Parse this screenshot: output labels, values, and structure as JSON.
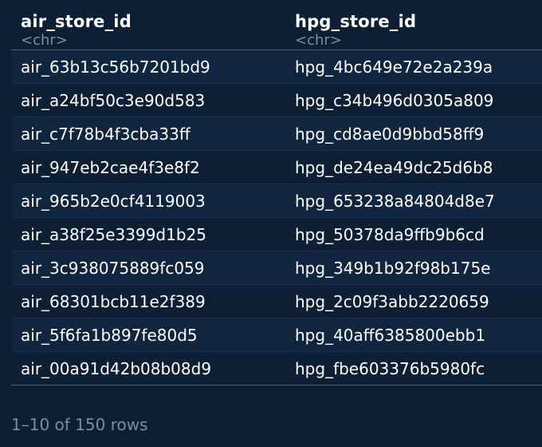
{
  "table": {
    "columns": [
      {
        "name": "air_store_id",
        "type": "<chr>"
      },
      {
        "name": "hpg_store_id",
        "type": "<chr>"
      }
    ],
    "rows": [
      [
        "air_63b13c56b7201bd9",
        "hpg_4bc649e72e2a239a"
      ],
      [
        "air_a24bf50c3e90d583",
        "hpg_c34b496d0305a809"
      ],
      [
        "air_c7f78b4f3cba33ff",
        "hpg_cd8ae0d9bbd58ff9"
      ],
      [
        "air_947eb2cae4f3e8f2",
        "hpg_de24ea49dc25d6b8"
      ],
      [
        "air_965b2e0cf4119003",
        "hpg_653238a84804d8e7"
      ],
      [
        "air_a38f25e3399d1b25",
        "hpg_50378da9ffb9b6cd"
      ],
      [
        "air_3c938075889fc059",
        "hpg_349b1b92f98b175e"
      ],
      [
        "air_68301bcb11e2f389",
        "hpg_2c09f3abb2220659"
      ],
      [
        "air_5f6fa1b897fe80d5",
        "hpg_40aff6385800ebb1"
      ],
      [
        "air_00a91d42b08b08d9",
        "hpg_fbe603376b5980fc"
      ]
    ]
  },
  "footer": {
    "pagination_text": "1–10 of 150 rows"
  }
}
